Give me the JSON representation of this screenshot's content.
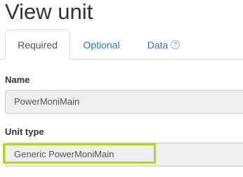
{
  "page": {
    "title": "View unit"
  },
  "tabs": [
    {
      "label": "Required"
    },
    {
      "label": "Optional"
    },
    {
      "label": "Data"
    }
  ],
  "fields": {
    "name": {
      "label": "Name",
      "value": "PowerMoniMain"
    },
    "unit_type": {
      "label": "Unit type",
      "value": "Generic PowerMoniMain"
    }
  },
  "colors": {
    "link": "#337ab7",
    "highlight": "#bcd02d",
    "input_bg": "#eeeeee"
  },
  "icons": {
    "data_tab_help": "help-circle-icon"
  }
}
